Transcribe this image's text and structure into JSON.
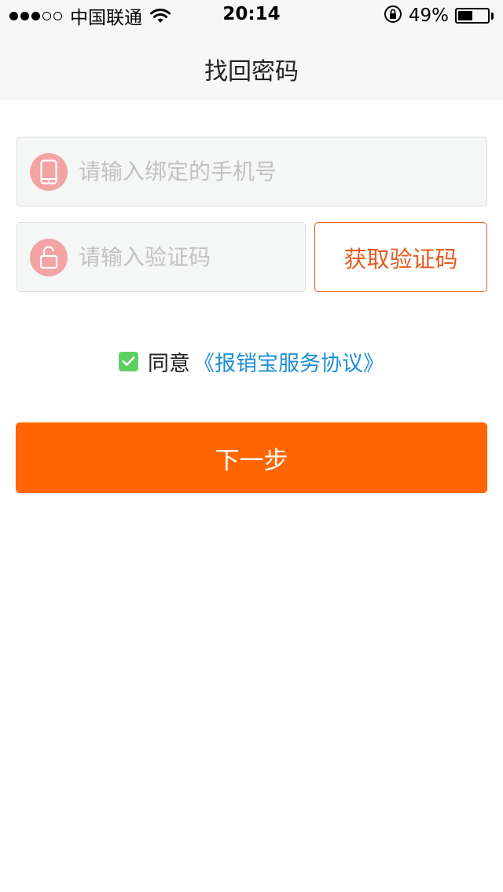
{
  "status_bar": {
    "carrier": "中国联通",
    "time": "20:14",
    "battery_percent": "49%",
    "battery_level": 0.49,
    "signal_bars_filled": 3,
    "signal_bars_total": 5,
    "icons": [
      "signal-dots-icon",
      "wifi-icon",
      "rotation-lock-icon",
      "battery-icon"
    ]
  },
  "navbar": {
    "title": "找回密码"
  },
  "form": {
    "phone": {
      "placeholder": "请输入绑定的手机号",
      "value": "",
      "icon": "phone-icon"
    },
    "code": {
      "placeholder": "请输入验证码",
      "value": "",
      "icon": "lock-icon"
    },
    "get_code_label": "获取验证码"
  },
  "agreement": {
    "checked": true,
    "prefix": "同意",
    "link_text": "《报销宝服务协议》"
  },
  "next_label": "下一步",
  "colors": {
    "accent": "#ff6603",
    "code_button": "#e85a1e",
    "link": "#1e8fd6",
    "checkbox": "#5ed063",
    "icon_circle": "#f3a3a3",
    "navbar_bg": "#f7f7f7"
  }
}
